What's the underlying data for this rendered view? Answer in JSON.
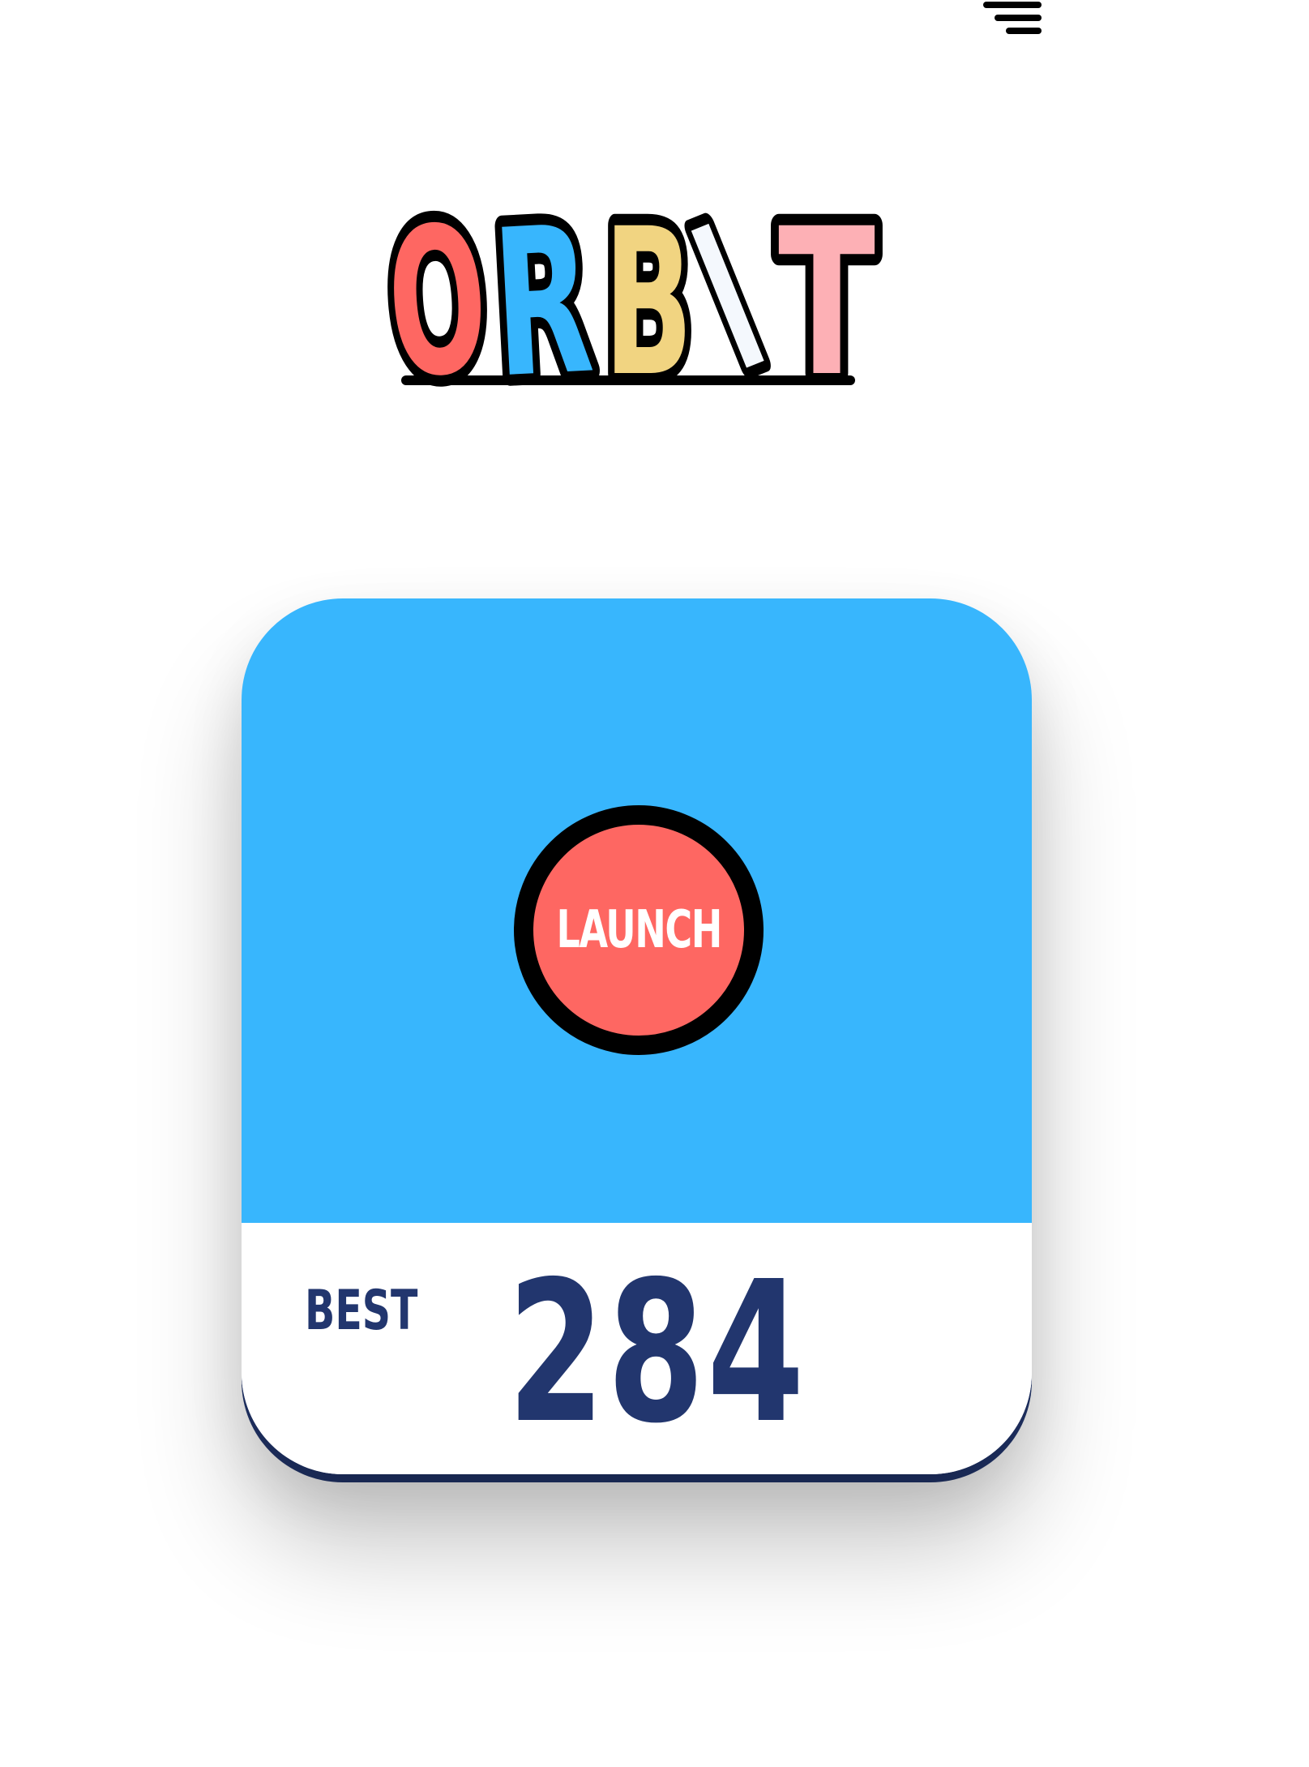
{
  "header": {
    "menu_icon": "menu-lines-icon"
  },
  "logo": {
    "letters": [
      {
        "char": "O",
        "color": "#fe6762"
      },
      {
        "char": "R",
        "color": "#38b6fd"
      },
      {
        "char": "B",
        "color": "#f1d481"
      },
      {
        "char": "I",
        "color": "#f4f8fd"
      },
      {
        "char": "T",
        "color": "#fdb0b5"
      }
    ]
  },
  "game": {
    "launch_label": "LAUNCH",
    "best_label": "BEST",
    "best_score": "284"
  },
  "colors": {
    "card_blue": "#38b6fd",
    "launch_red": "#fe6762",
    "navy": "#22366e"
  }
}
